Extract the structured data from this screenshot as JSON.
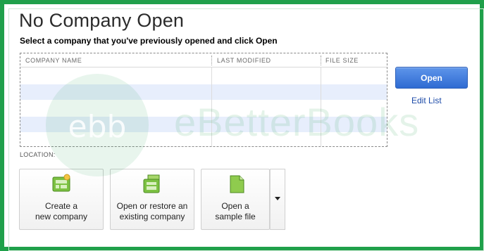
{
  "window": {
    "title": "No Company Open",
    "subtitle": "Select a company that you've previously opened and click Open"
  },
  "table": {
    "columns": [
      "COMPANY NAME",
      "LAST MODIFIED",
      "FILE SIZE"
    ],
    "rows": []
  },
  "actions": {
    "open_label": "Open",
    "edit_list_label": "Edit List"
  },
  "location": {
    "label": "LOCATION:"
  },
  "tiles": [
    {
      "line1": "Create a",
      "line2": "new company",
      "icon": "new-company-icon"
    },
    {
      "line1": "Open or restore an",
      "line2": "existing company",
      "icon": "restore-company-icon"
    },
    {
      "line1": "Open a",
      "line2": "sample file",
      "icon": "sample-file-icon"
    }
  ],
  "watermark": {
    "text": "eBetterBooks"
  },
  "colors": {
    "frame": "#1fa04a",
    "accent": "#2f6bd2",
    "row_alt": "#e7eefc"
  }
}
